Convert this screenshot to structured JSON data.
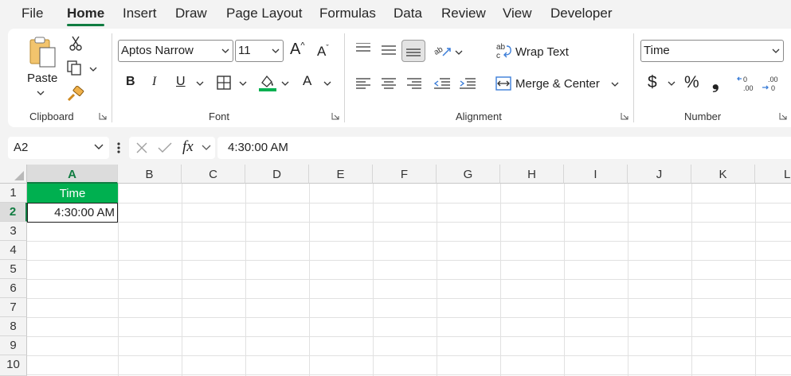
{
  "menu": {
    "tabs": [
      "File",
      "Home",
      "Insert",
      "Draw",
      "Page Layout",
      "Formulas",
      "Data",
      "Review",
      "View",
      "Developer"
    ],
    "active": "Home"
  },
  "ribbon": {
    "clipboard": {
      "paste_label": "Paste",
      "group_label": "Clipboard"
    },
    "font": {
      "font_name": "Aptos Narrow",
      "font_size": "11",
      "group_label": "Font",
      "bold": "B",
      "italic": "I",
      "underline": "U",
      "grow": "A",
      "shrink": "A",
      "font_color": "A",
      "fill_color_hex": "#00b050"
    },
    "alignment": {
      "wrap_text": "Wrap Text",
      "merge_center": "Merge & Center",
      "group_label": "Alignment"
    },
    "number": {
      "format": "Time",
      "currency": "$",
      "percent": "%",
      "comma": "❟",
      "group_label": "Number"
    }
  },
  "formula_bar": {
    "name_box": "A2",
    "fx": "fx",
    "content": "4:30:00 AM"
  },
  "sheet": {
    "columns": [
      "A",
      "B",
      "C",
      "D",
      "E",
      "F",
      "G",
      "H",
      "I",
      "J",
      "K",
      "L"
    ],
    "selected_column": "A",
    "rows": [
      "1",
      "2",
      "3",
      "4",
      "5",
      "6",
      "7",
      "8",
      "9",
      "10"
    ],
    "selected_row": "2",
    "cells": {
      "A1": "Time",
      "A2": "4:30:00 AM"
    },
    "header_fill_hex": "#00b050"
  }
}
